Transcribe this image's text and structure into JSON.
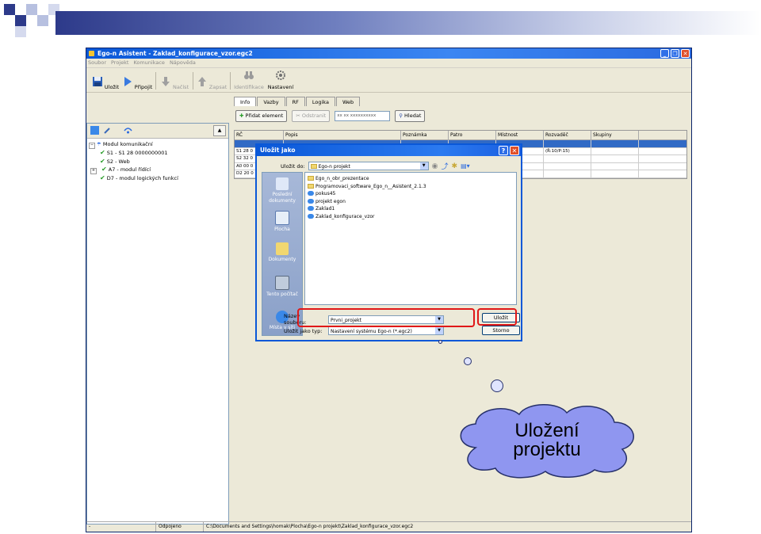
{
  "app": {
    "title": "Ego-n Asistent - Zaklad_konfigurace_vzor.egc2",
    "menu": [
      "Soubor",
      "Projekt",
      "Komunikace",
      "Nápověda"
    ],
    "toolbar": [
      "Uložit",
      "Připojit",
      "Načíst",
      "Zapsat",
      "Identifikace",
      "Nastavení"
    ],
    "tree": [
      {
        "label": "Modul komunikační",
        "level": 0
      },
      {
        "label": "S1 - S1 28 0000000001",
        "level": 1
      },
      {
        "label": "S2 - Web",
        "level": 1
      },
      {
        "label": "A7 - modul řídící",
        "level": 1
      },
      {
        "label": "D7 - modul logických funkcí",
        "level": 1
      }
    ],
    "tabs": [
      "Info",
      "Vazby",
      "RF",
      "Logika",
      "Web"
    ],
    "actions": {
      "add": "Přidat element",
      "remove": "Odstranit",
      "search_value": "xx xx xxxxxxxxxx",
      "search": "Hledat"
    },
    "grid": {
      "headers": [
        "RČ",
        "Popis",
        "Poznámka",
        "Patro",
        "Místnost",
        "Rozvaděč",
        "Skupiny"
      ],
      "rows": [
        [
          "",
          "",
          "",
          "",
          "",
          "",
          ""
        ],
        [
          "S1 28 0",
          "",
          "",
          "",
          "",
          "(Ř:10/P:15)",
          ""
        ],
        [
          "S2 32 0",
          "",
          "",
          "",
          "",
          "",
          ""
        ],
        [
          "A0 00 0",
          "",
          "",
          "",
          "",
          "",
          ""
        ],
        [
          "D2 20 0",
          "",
          "",
          "",
          "",
          "",
          ""
        ]
      ]
    },
    "status": {
      "state": "Odpojeno",
      "path": "C:\\Documents and Settings\\homak\\Plocha\\Ego-n projekt\\Zaklad_konfigurace_vzor.egc2"
    }
  },
  "dialog": {
    "title": "Uložit jako",
    "look_in_label": "Uložit do:",
    "look_in_value": "Ego-n projekt",
    "places": [
      "Poslední dokumenty",
      "Plocha",
      "Dokumenty",
      "Tento počítač",
      "Místa v síti"
    ],
    "files": [
      {
        "name": "Ego_n_obr_prezentace",
        "type": "folder"
      },
      {
        "name": "Programovaci_software_Ego_n__Asistent_2.1.3",
        "type": "folder"
      },
      {
        "name": "pokus45",
        "type": "file"
      },
      {
        "name": "projekt egon",
        "type": "file"
      },
      {
        "name": "Zaklad1",
        "type": "file"
      },
      {
        "name": "Zaklad_konfigurace_vzor",
        "type": "file"
      }
    ],
    "filename_label": "Název souboru:",
    "filename_value": "Prvni_projekt",
    "filetype_label": "Uložit jako typ:",
    "filetype_value": "Nastavení systému Ego-n (*.egc2)",
    "save": "Uložit",
    "cancel": "Storno"
  },
  "callout": "Uložení projektu",
  "colors": {
    "accent": "#0a58d8",
    "highlight": "#e01818",
    "cloud": "#8f96f0"
  }
}
